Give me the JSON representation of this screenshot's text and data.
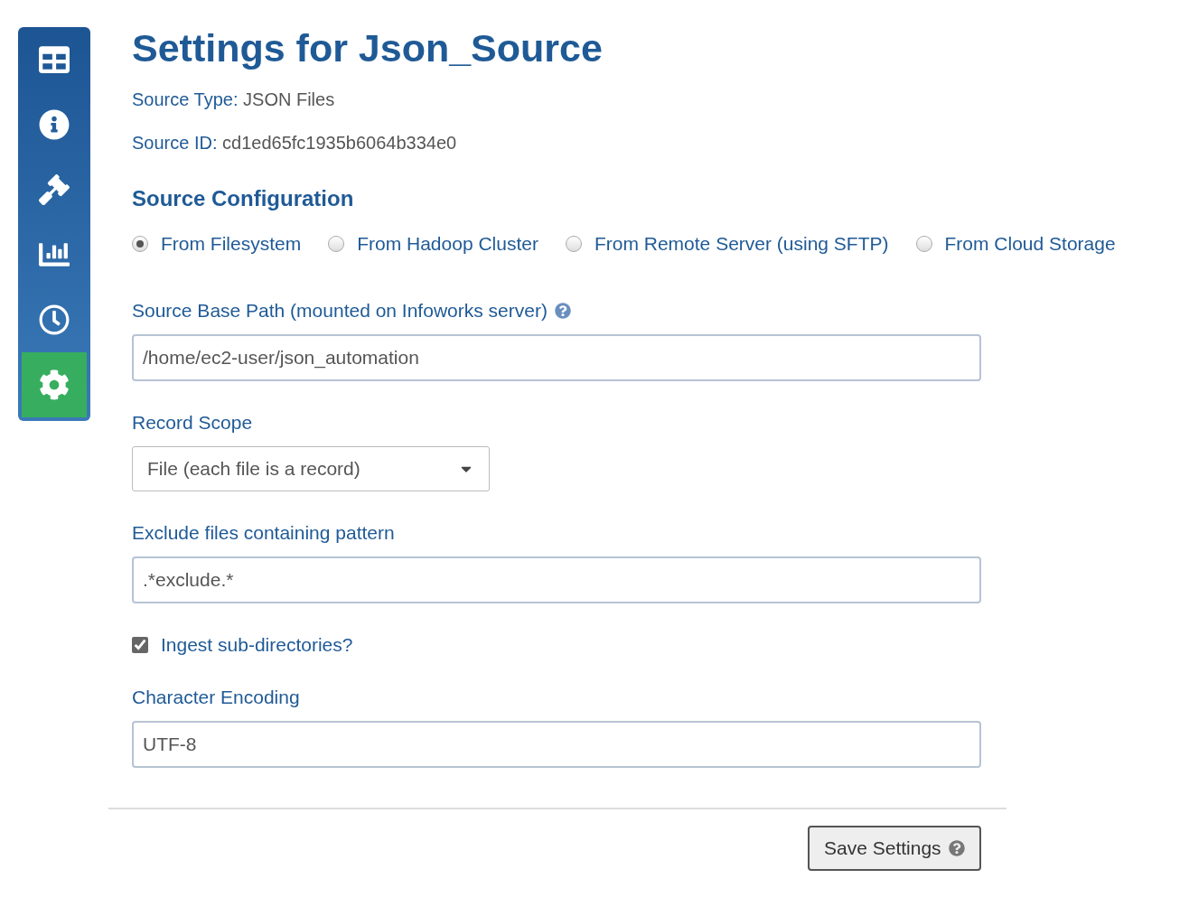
{
  "sidebar": {
    "items": [
      {
        "kind": "table",
        "selected": false
      },
      {
        "kind": "info",
        "selected": false
      },
      {
        "kind": "gavel",
        "selected": false
      },
      {
        "kind": "chart",
        "selected": false
      },
      {
        "kind": "clock",
        "selected": false
      },
      {
        "kind": "settings",
        "selected": true
      }
    ]
  },
  "title": "Settings for Json_Source",
  "meta": [
    {
      "label": "Source Type:",
      "value": "JSON Files"
    },
    {
      "label": "Source ID:",
      "value": "cd1ed65fc1935b6064b334e0"
    }
  ],
  "section_title": "Source Configuration",
  "source_options": [
    {
      "label": "From Filesystem",
      "selected": true
    },
    {
      "label": "From Hadoop Cluster",
      "selected": false
    },
    {
      "label": "From Remote Server (using SFTP)",
      "selected": false
    },
    {
      "label": "From Cloud Storage",
      "selected": false
    }
  ],
  "fields": [
    {
      "kind": "text",
      "label": "Source Base Path (mounted on Infoworks server)",
      "help": true,
      "value": "/home/ec2-user/json_automation"
    },
    {
      "kind": "select",
      "label": "Record Scope",
      "value": "File (each file is a record)"
    },
    {
      "kind": "text",
      "label": "Exclude files containing pattern",
      "value": ".*exclude.*"
    },
    {
      "kind": "checkbox",
      "label": "Ingest sub-directories?",
      "checked": true
    },
    {
      "kind": "text",
      "label": "Character Encoding",
      "value": "UTF-8"
    }
  ],
  "save_button": {
    "label": "Save Settings"
  }
}
